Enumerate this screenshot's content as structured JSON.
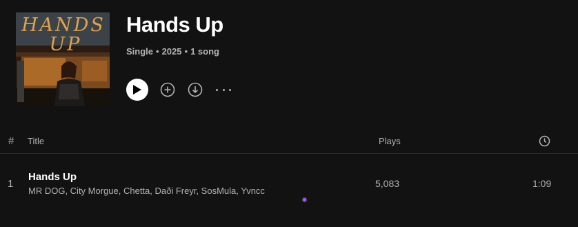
{
  "album": {
    "cover_text_line1": "HANDS",
    "cover_text_line2": "UP",
    "title": "Hands Up",
    "type": "Single",
    "year": "2025",
    "song_count": "1 song",
    "separator": "•"
  },
  "controls": {
    "play_icon": "play-icon",
    "add_icon": "add-circle-icon",
    "download_icon": "download-circle-icon",
    "more_icon": "more-options-icon"
  },
  "tracklist": {
    "header": {
      "number": "#",
      "title": "Title",
      "plays": "Plays",
      "duration_icon": "clock-icon"
    },
    "tracks": [
      {
        "number": "1",
        "title": "Hands Up",
        "artists": "MR DOG, City Morgue, Chetta, Daði Freyr, SosMula, Yvncc",
        "plays": "5,083",
        "duration": "1:09"
      }
    ]
  },
  "colors": {
    "background": "#121212",
    "primary_text": "#ffffff",
    "secondary_text": "#b3b3b3",
    "cover_lettering": "#e0a24a",
    "cursor_accent": "#9b59ff"
  }
}
